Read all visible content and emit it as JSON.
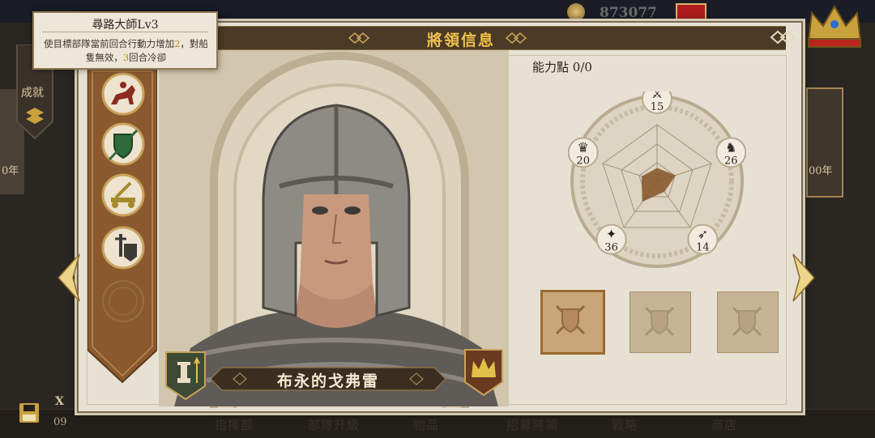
{
  "window": {
    "title": "將領信息"
  },
  "topbar": {
    "gold_value": "873077"
  },
  "tooltip": {
    "title": "尋路大師Lv3",
    "desc_prefix": "使目標部隊當前回合行動力增加",
    "desc_value1": "2",
    "desc_mid": "，對船隻無效，",
    "desc_value2": "3",
    "desc_suffix": "回合冷卻"
  },
  "left_sidebar": {
    "achievement_label": "成就",
    "year_fragment": "0年"
  },
  "right_sidebar": {
    "year_fragment": "00年"
  },
  "general": {
    "name": "布永的戈弗雷"
  },
  "ability": {
    "label": "能力點",
    "points_value": "0/0",
    "stats": [
      {
        "icon": "swords-icon",
        "value": "15"
      },
      {
        "icon": "knight-icon",
        "value": "26"
      },
      {
        "icon": "bow-icon",
        "value": "14"
      },
      {
        "icon": "eagle-icon",
        "value": "36"
      },
      {
        "icon": "crown-icon",
        "value": "20"
      }
    ]
  },
  "skills": [
    {
      "name": "cavalry-skill-icon"
    },
    {
      "name": "shield-skill-icon"
    },
    {
      "name": "siege-skill-icon"
    },
    {
      "name": "infantry-skill-icon"
    },
    {
      "name": "locked-skill-icon"
    }
  ],
  "equipment_slots": [
    {
      "selected": true
    },
    {
      "selected": false
    },
    {
      "selected": false
    }
  ],
  "bottom_tabs": [
    "指揮部",
    "部隊升級",
    "物品",
    "招募將領",
    "戰略",
    "商店"
  ],
  "bottom_left": {
    "counter_label": "X",
    "counter_value": "09"
  },
  "colors": {
    "accent_gold": "#f0c24a",
    "header_bg": "#4a3a26",
    "panel_bg": "#e7e1d4",
    "banner_brown": "#8a5a2e"
  }
}
